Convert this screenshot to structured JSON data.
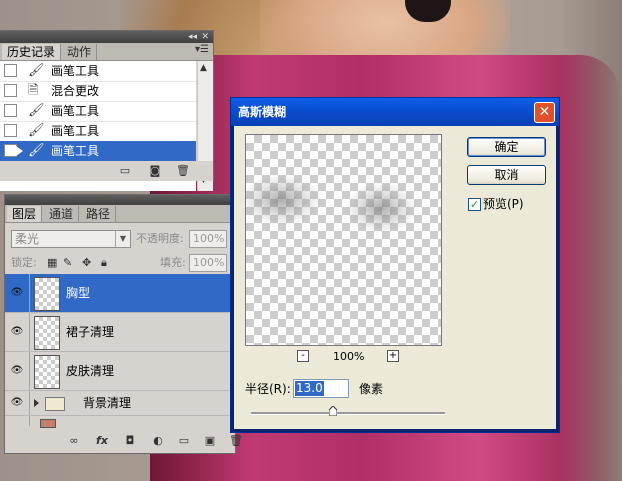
{
  "history_panel": {
    "tabs": [
      "历史记录",
      "动作"
    ],
    "menu_icon": "panel-menu-icon",
    "items": [
      {
        "label": "画笔工具",
        "icon": "brush-icon",
        "selected": false
      },
      {
        "label": "混合更改",
        "icon": "document-icon",
        "selected": false
      },
      {
        "label": "画笔工具",
        "icon": "brush-icon",
        "selected": false
      },
      {
        "label": "画笔工具",
        "icon": "brush-icon",
        "selected": false
      },
      {
        "label": "画笔工具",
        "icon": "brush-icon",
        "selected": true
      }
    ],
    "footer_icons": [
      "new-document-from-state-icon",
      "camera-snapshot-icon",
      "trash-icon"
    ]
  },
  "layers_panel": {
    "tabs": [
      "图层",
      "通道",
      "路径"
    ],
    "blend_mode": "柔光",
    "opacity_label": "不透明度:",
    "opacity_value": "100%",
    "lock_label": "锁定:",
    "fill_label": "填充:",
    "fill_value": "100%",
    "layers": [
      {
        "name": "胸型",
        "type": "layer",
        "selected": true
      },
      {
        "name": "裙子清理",
        "type": "layer",
        "selected": false
      },
      {
        "name": "皮肤清理",
        "type": "layer",
        "selected": false
      },
      {
        "name": "背景清理",
        "type": "group",
        "selected": false
      }
    ],
    "footer_icons": [
      "link-icon",
      "fx-icon",
      "mask-icon",
      "adjustment-icon",
      "folder-icon",
      "new-layer-icon",
      "trash-icon"
    ]
  },
  "dialog": {
    "title": "高斯模糊",
    "ok_label": "确定",
    "cancel_label": "取消",
    "preview_label": "预览(P)",
    "preview_checked": true,
    "zoom_minus": "-",
    "zoom_plus": "+",
    "zoom_level": "100%",
    "radius_label": "半径(R):",
    "radius_value": "13.0",
    "radius_unit": "像素",
    "accent_color": "#0a49c8",
    "close_color": "#e0502a"
  }
}
